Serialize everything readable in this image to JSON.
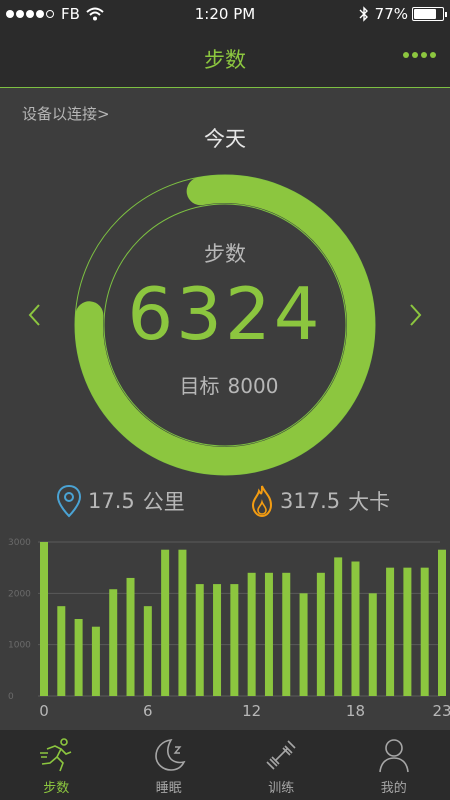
{
  "status_bar": {
    "carrier": "FB",
    "time": "1:20 PM",
    "battery": "77%",
    "battery_level": 0.77
  },
  "nav": {
    "title": "步数",
    "more_icon": "more-dots-icon"
  },
  "device_status": "设备以连接>",
  "day_title": "今天",
  "ring": {
    "label": "步数",
    "value": "6324",
    "goal_label": "目标",
    "goal_value": "8000",
    "progress": 0.79
  },
  "stats": {
    "distance_value": "17.5",
    "distance_unit": "公里",
    "calories_value": "317.5",
    "calories_unit": "大卡"
  },
  "chart_data": {
    "type": "bar",
    "x": [
      0,
      1,
      2,
      3,
      4,
      5,
      6,
      7,
      8,
      9,
      10,
      11,
      12,
      13,
      14,
      15,
      16,
      17,
      18,
      19,
      20,
      21,
      22,
      23
    ],
    "values": [
      3000,
      1750,
      1500,
      1350,
      2080,
      2300,
      1750,
      2850,
      2850,
      2180,
      2180,
      2180,
      2400,
      2400,
      2400,
      2000,
      2400,
      2700,
      2620,
      2000,
      2500,
      2500,
      2500,
      2850
    ],
    "x_ticks": [
      "0",
      "6",
      "12",
      "18",
      "23"
    ],
    "y_ticks": [
      "3000",
      "2000",
      "1000",
      "0"
    ],
    "ylim": [
      0,
      3000
    ],
    "grid": true,
    "bar_color": "#8cc63f"
  },
  "tabs": [
    {
      "label": "步数",
      "icon": "running-icon",
      "active": true
    },
    {
      "label": "睡眠",
      "icon": "moon-icon",
      "active": false
    },
    {
      "label": "训练",
      "icon": "dumbbell-icon",
      "active": false
    },
    {
      "label": "我的",
      "icon": "user-icon",
      "active": false
    }
  ],
  "colors": {
    "accent": "#8cc63f",
    "background": "#3d3d3d",
    "bar_background": "#2b2b2b",
    "location_icon": "#4aa3d4",
    "calories_icon": "#f39c12"
  }
}
